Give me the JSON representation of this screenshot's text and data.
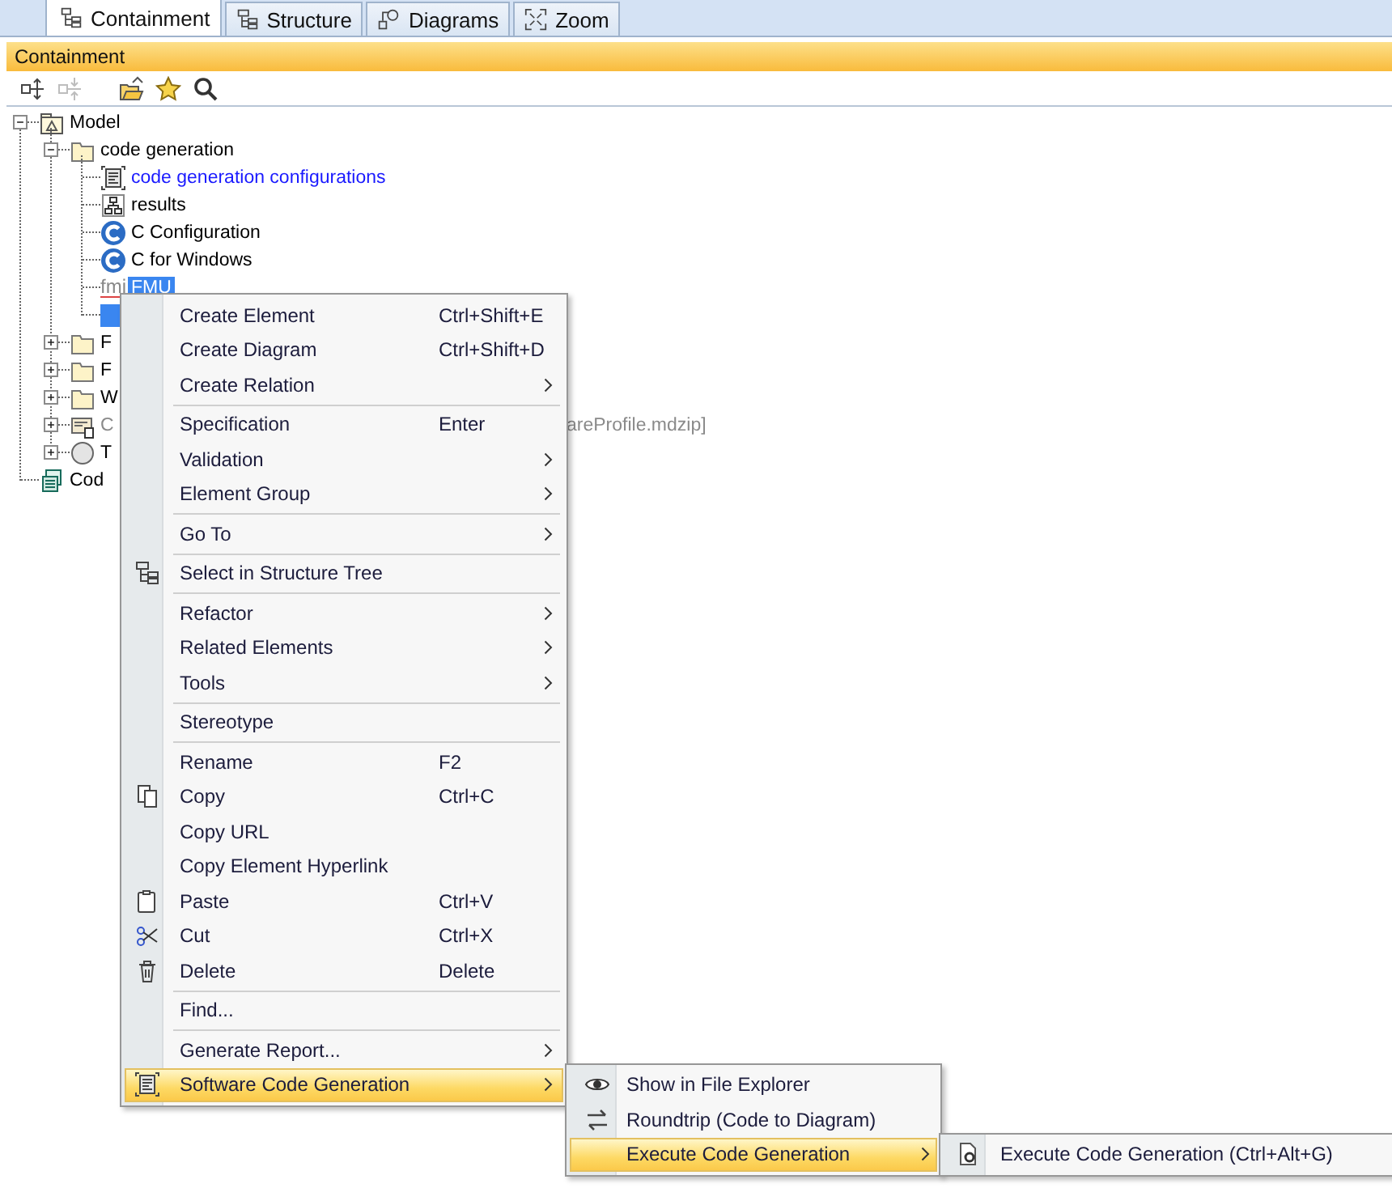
{
  "tabs": [
    {
      "label": "Containment",
      "selected": true
    },
    {
      "label": "Structure",
      "selected": false
    },
    {
      "label": "Diagrams",
      "selected": false
    },
    {
      "label": "Zoom",
      "selected": false
    }
  ],
  "panel": {
    "title": "Containment"
  },
  "toolbar": [
    {
      "disabled": false
    },
    {
      "disabled": true
    },
    {
      "disabled": false
    },
    {
      "disabled": false
    },
    {
      "disabled": false
    }
  ],
  "tree": [
    {
      "label": "Model",
      "kind": "package",
      "expanded": true,
      "selected": false,
      "color": "#000000",
      "children": [
        {
          "label": "code generation",
          "kind": "folder",
          "expanded": true,
          "selected": false,
          "color": "#000000",
          "children": [
            {
              "label": "code generation configurations",
              "kind": "configuration",
              "selected": false,
              "color": "#1a1aff"
            },
            {
              "label": "results",
              "kind": "diagram",
              "selected": false,
              "color": "#000000"
            },
            {
              "label": "C Configuration",
              "kind": "language",
              "selected": false,
              "color": "#000000"
            },
            {
              "label": "C for Windows",
              "kind": "language",
              "selected": false,
              "color": "#000000"
            },
            {
              "label": "FMU",
              "icon_text": "fmi",
              "selected": true
            },
            {
              "selected": true
            }
          ]
        },
        {
          "label": "F",
          "kind": "folder",
          "expanded": false,
          "selected": false,
          "color": "#000000"
        },
        {
          "label": "F",
          "kind": "folder",
          "expanded": false,
          "selected": false,
          "color": "#000000"
        },
        {
          "label": "W",
          "kind": "folder",
          "expanded": false,
          "selected": false,
          "color": "#000000"
        },
        {
          "label": "C",
          "kind": "profile",
          "expanded": false,
          "selected": false,
          "color": "#8a8a8a",
          "tail": "areProfile.mdzip]"
        },
        {
          "label": "T",
          "kind": "element",
          "expanded": false,
          "selected": false,
          "color": "#000000"
        }
      ]
    },
    {
      "label": "Cod",
      "kind": "module",
      "selected": false,
      "color": "#000000"
    }
  ],
  "context_menu": {
    "items": [
      {
        "kind": "item",
        "label": "Create Element",
        "shortcut": "Ctrl+Shift+E",
        "submenu": false,
        "highlighted": false
      },
      {
        "kind": "item",
        "label": "Create Diagram",
        "shortcut": "Ctrl+Shift+D",
        "submenu": false,
        "highlighted": false
      },
      {
        "kind": "item",
        "label": "Create Relation",
        "submenu": true,
        "highlighted": false
      },
      {
        "kind": "separator"
      },
      {
        "kind": "item",
        "label": "Specification",
        "shortcut": "Enter",
        "submenu": false,
        "highlighted": false
      },
      {
        "kind": "item",
        "label": "Validation",
        "submenu": true,
        "highlighted": false
      },
      {
        "kind": "item",
        "label": "Element Group",
        "submenu": true,
        "highlighted": false
      },
      {
        "kind": "separator"
      },
      {
        "kind": "item",
        "label": "Go To",
        "submenu": true,
        "highlighted": false
      },
      {
        "kind": "separator"
      },
      {
        "kind": "item",
        "label": "Select in Structure Tree",
        "submenu": false,
        "highlighted": false
      },
      {
        "kind": "separator"
      },
      {
        "kind": "item",
        "label": "Refactor",
        "submenu": true,
        "highlighted": false
      },
      {
        "kind": "item",
        "label": "Related Elements",
        "submenu": true,
        "highlighted": false
      },
      {
        "kind": "item",
        "label": "Tools",
        "submenu": true,
        "highlighted": false
      },
      {
        "kind": "separator"
      },
      {
        "kind": "item",
        "label": "Stereotype",
        "submenu": false,
        "highlighted": false
      },
      {
        "kind": "separator"
      },
      {
        "kind": "item",
        "label": "Rename",
        "shortcut": "F2",
        "submenu": false,
        "highlighted": false
      },
      {
        "kind": "item",
        "label": "Copy",
        "shortcut": "Ctrl+C",
        "submenu": false,
        "highlighted": false
      },
      {
        "kind": "item",
        "label": "Copy URL",
        "submenu": false,
        "highlighted": false
      },
      {
        "kind": "item",
        "label": "Copy Element Hyperlink",
        "submenu": false,
        "highlighted": false
      },
      {
        "kind": "item",
        "label": "Paste",
        "shortcut": "Ctrl+V",
        "submenu": false,
        "highlighted": false
      },
      {
        "kind": "item",
        "label": "Cut",
        "shortcut": "Ctrl+X",
        "submenu": false,
        "highlighted": false
      },
      {
        "kind": "item",
        "label": "Delete",
        "shortcut": "Delete",
        "submenu": false,
        "highlighted": false
      },
      {
        "kind": "separator"
      },
      {
        "kind": "item",
        "label": "Find...",
        "submenu": false,
        "highlighted": false
      },
      {
        "kind": "separator"
      },
      {
        "kind": "item",
        "label": "Generate Report...",
        "submenu": true,
        "highlighted": false
      },
      {
        "kind": "item",
        "label": "Software Code Generation",
        "submenu": true,
        "highlighted": true,
        "children": [
          {
            "kind": "item",
            "label": "Show in File Explorer",
            "submenu": false,
            "highlighted": false
          },
          {
            "kind": "item",
            "label": "Roundtrip (Code to Diagram)",
            "submenu": false,
            "highlighted": false
          },
          {
            "kind": "item",
            "label": "Execute Code Generation",
            "submenu": true,
            "highlighted": true,
            "children": [
              {
                "kind": "item",
                "label": "Execute Code Generation (Ctrl+Alt+G)",
                "submenu": false,
                "highlighted": false
              }
            ]
          }
        ]
      }
    ]
  }
}
